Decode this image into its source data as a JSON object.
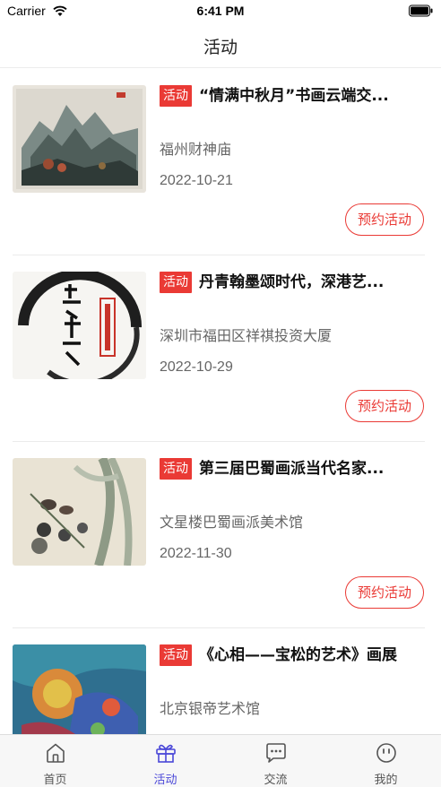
{
  "status_bar": {
    "carrier": "Carrier",
    "time": "6:41 PM"
  },
  "nav": {
    "title": "活动"
  },
  "activities": [
    {
      "tag": "活动",
      "title": "“情满中秋月”书画云端交...",
      "location": "福州财神庙",
      "date": "2022-10-21",
      "button": "预约活动",
      "image": "landscape-painting"
    },
    {
      "tag": "活动",
      "title": "丹青翰墨颂时代，深港艺...",
      "location": "深圳市福田区祥祺投资大厦",
      "date": "2022-10-29",
      "button": "预约活动",
      "image": "calligraphy-ink-circle"
    },
    {
      "tag": "活动",
      "title": "第三届巴蜀画派当代名家...",
      "location": "文星楼巴蜀画派美术馆",
      "date": "2022-11-30",
      "button": "预约活动",
      "image": "bird-flower-painting"
    },
    {
      "tag": "活动",
      "title": "《心相——宝松的艺术》画展",
      "location": "北京银帝艺术馆",
      "date": "",
      "button": "",
      "image": "colorful-figure-painting"
    }
  ],
  "tabs": [
    {
      "label": "首页",
      "icon": "home-icon",
      "active": false
    },
    {
      "label": "活动",
      "icon": "gift-icon",
      "active": true
    },
    {
      "label": "交流",
      "icon": "chat-icon",
      "active": false
    },
    {
      "label": "我的",
      "icon": "profile-icon",
      "active": false
    }
  ],
  "colors": {
    "accent_red": "#ea3a35",
    "tab_active": "#4a47d8",
    "tab_inactive": "#555555"
  }
}
